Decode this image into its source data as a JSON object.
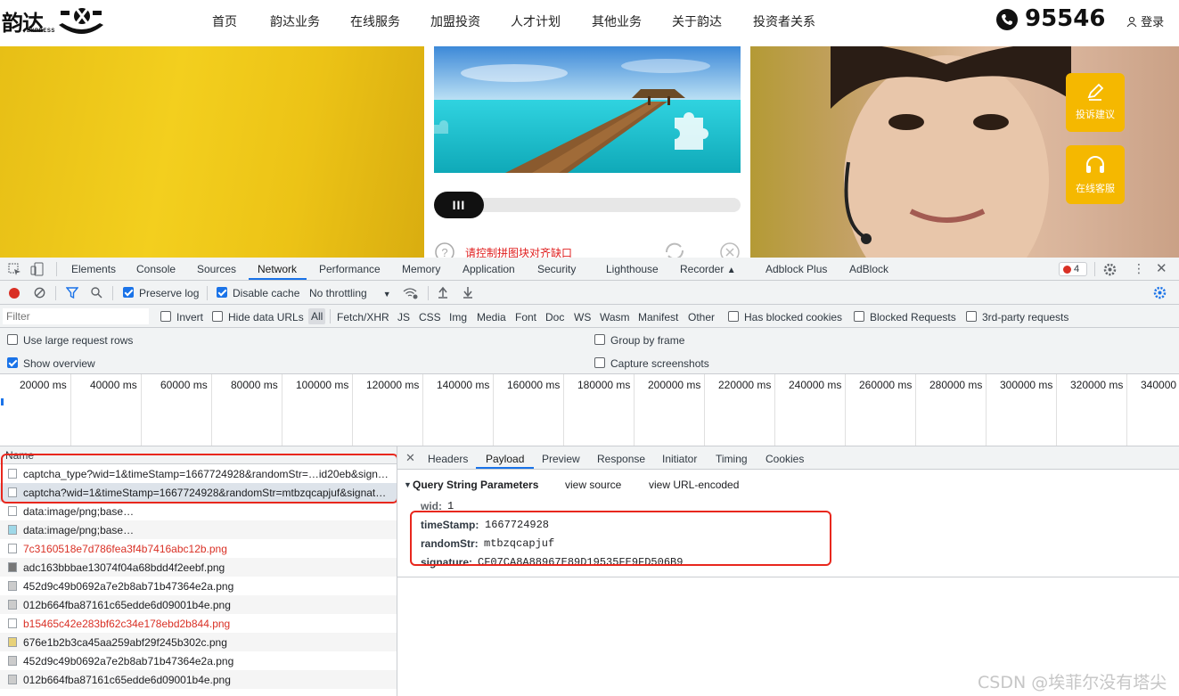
{
  "site": {
    "logo": "韵达",
    "logo_sub": "EXPRESS",
    "nav": [
      "首页",
      "韵达业务",
      "在线服务",
      "加盟投资",
      "人才计划",
      "其他业务",
      "关于韵达",
      "投资者关系"
    ],
    "phone": "95546",
    "login": "登录",
    "captcha_hint": "请控制拼图块对齐缺口",
    "slider_knob": "III",
    "side_buttons": [
      "投诉建议",
      "在线客服"
    ],
    "brand_yellow": "#f5b800"
  },
  "devtools": {
    "tabs": [
      "Elements",
      "Console",
      "Sources",
      "Network",
      "Performance",
      "Memory",
      "Application",
      "Security",
      "Lighthouse",
      "Recorder",
      "Adblock Plus",
      "AdBlock"
    ],
    "active_tab": "Network",
    "error_count": "4",
    "toolbar": {
      "preserve_log": "Preserve log",
      "disable_cache": "Disable cache",
      "throttling": "No throttling"
    },
    "filter": {
      "placeholder": "Filter",
      "invert": "Invert",
      "hide_data_urls": "Hide data URLs",
      "types": [
        "All",
        "Fetch/XHR",
        "JS",
        "CSS",
        "Img",
        "Media",
        "Font",
        "Doc",
        "WS",
        "Wasm",
        "Manifest",
        "Other"
      ],
      "has_blocked_cookies": "Has blocked cookies",
      "blocked_requests": "Blocked Requests",
      "third_party": "3rd-party requests"
    },
    "options": {
      "large_rows": "Use large request rows",
      "show_overview": "Show overview",
      "group_by_frame": "Group by frame",
      "capture_screenshots": "Capture screenshots"
    },
    "timeline_ticks": [
      "20000 ms",
      "40000 ms",
      "60000 ms",
      "80000 ms",
      "100000 ms",
      "120000 ms",
      "140000 ms",
      "160000 ms",
      "180000 ms",
      "200000 ms",
      "220000 ms",
      "240000 ms",
      "260000 ms",
      "280000 ms",
      "300000 ms",
      "320000 ms",
      "340000"
    ],
    "list_header": "Name",
    "requests": [
      {
        "name": "captcha_type?wid=1&timeStamp=1667724928&randomStr=…id20eb&sign…",
        "error": false
      },
      {
        "name": "captcha?wid=1&timeStamp=1667724928&randomStr=mtbzqcapjuf&signat…",
        "error": false
      },
      {
        "name": "data:image/png;base…",
        "error": false
      },
      {
        "name": "data:image/png;base…",
        "error": false
      },
      {
        "name": "7c3160518e7d786fea3f4b7416abc12b.png",
        "error": true
      },
      {
        "name": "adc163bbbae13074f04a68bdd4f2eebf.png",
        "error": false
      },
      {
        "name": "452d9c49b0692a7e2b8ab71b47364e2a.png",
        "error": false
      },
      {
        "name": "012b664fba87161c65edde6d09001b4e.png",
        "error": false
      },
      {
        "name": "b15465c42e283bf62c34e178ebd2b844.png",
        "error": true
      },
      {
        "name": "676e1b2b3ca45aa259abf29f245b302c.png",
        "error": false
      },
      {
        "name": "452d9c49b0692a7e2b8ab71b47364e2a.png",
        "error": false
      },
      {
        "name": "012b664fba87161c65edde6d09001b4e.png",
        "error": false
      }
    ],
    "detail_tabs": [
      "Headers",
      "Payload",
      "Preview",
      "Response",
      "Initiator",
      "Timing",
      "Cookies"
    ],
    "active_detail_tab": "Payload",
    "payload": {
      "section": "Query String Parameters",
      "view_source": "view source",
      "view_url_encoded": "view URL-encoded",
      "params": [
        {
          "key": "wid:",
          "value": "1"
        },
        {
          "key": "timeStamp:",
          "value": "1667724928"
        },
        {
          "key": "randomStr:",
          "value": "mtbzqcapjuf"
        },
        {
          "key": "signature:",
          "value": "CF07CA8A88967E89D19535FE9FD506B9"
        }
      ]
    }
  },
  "watermark": "CSDN @埃菲尔没有塔尖"
}
